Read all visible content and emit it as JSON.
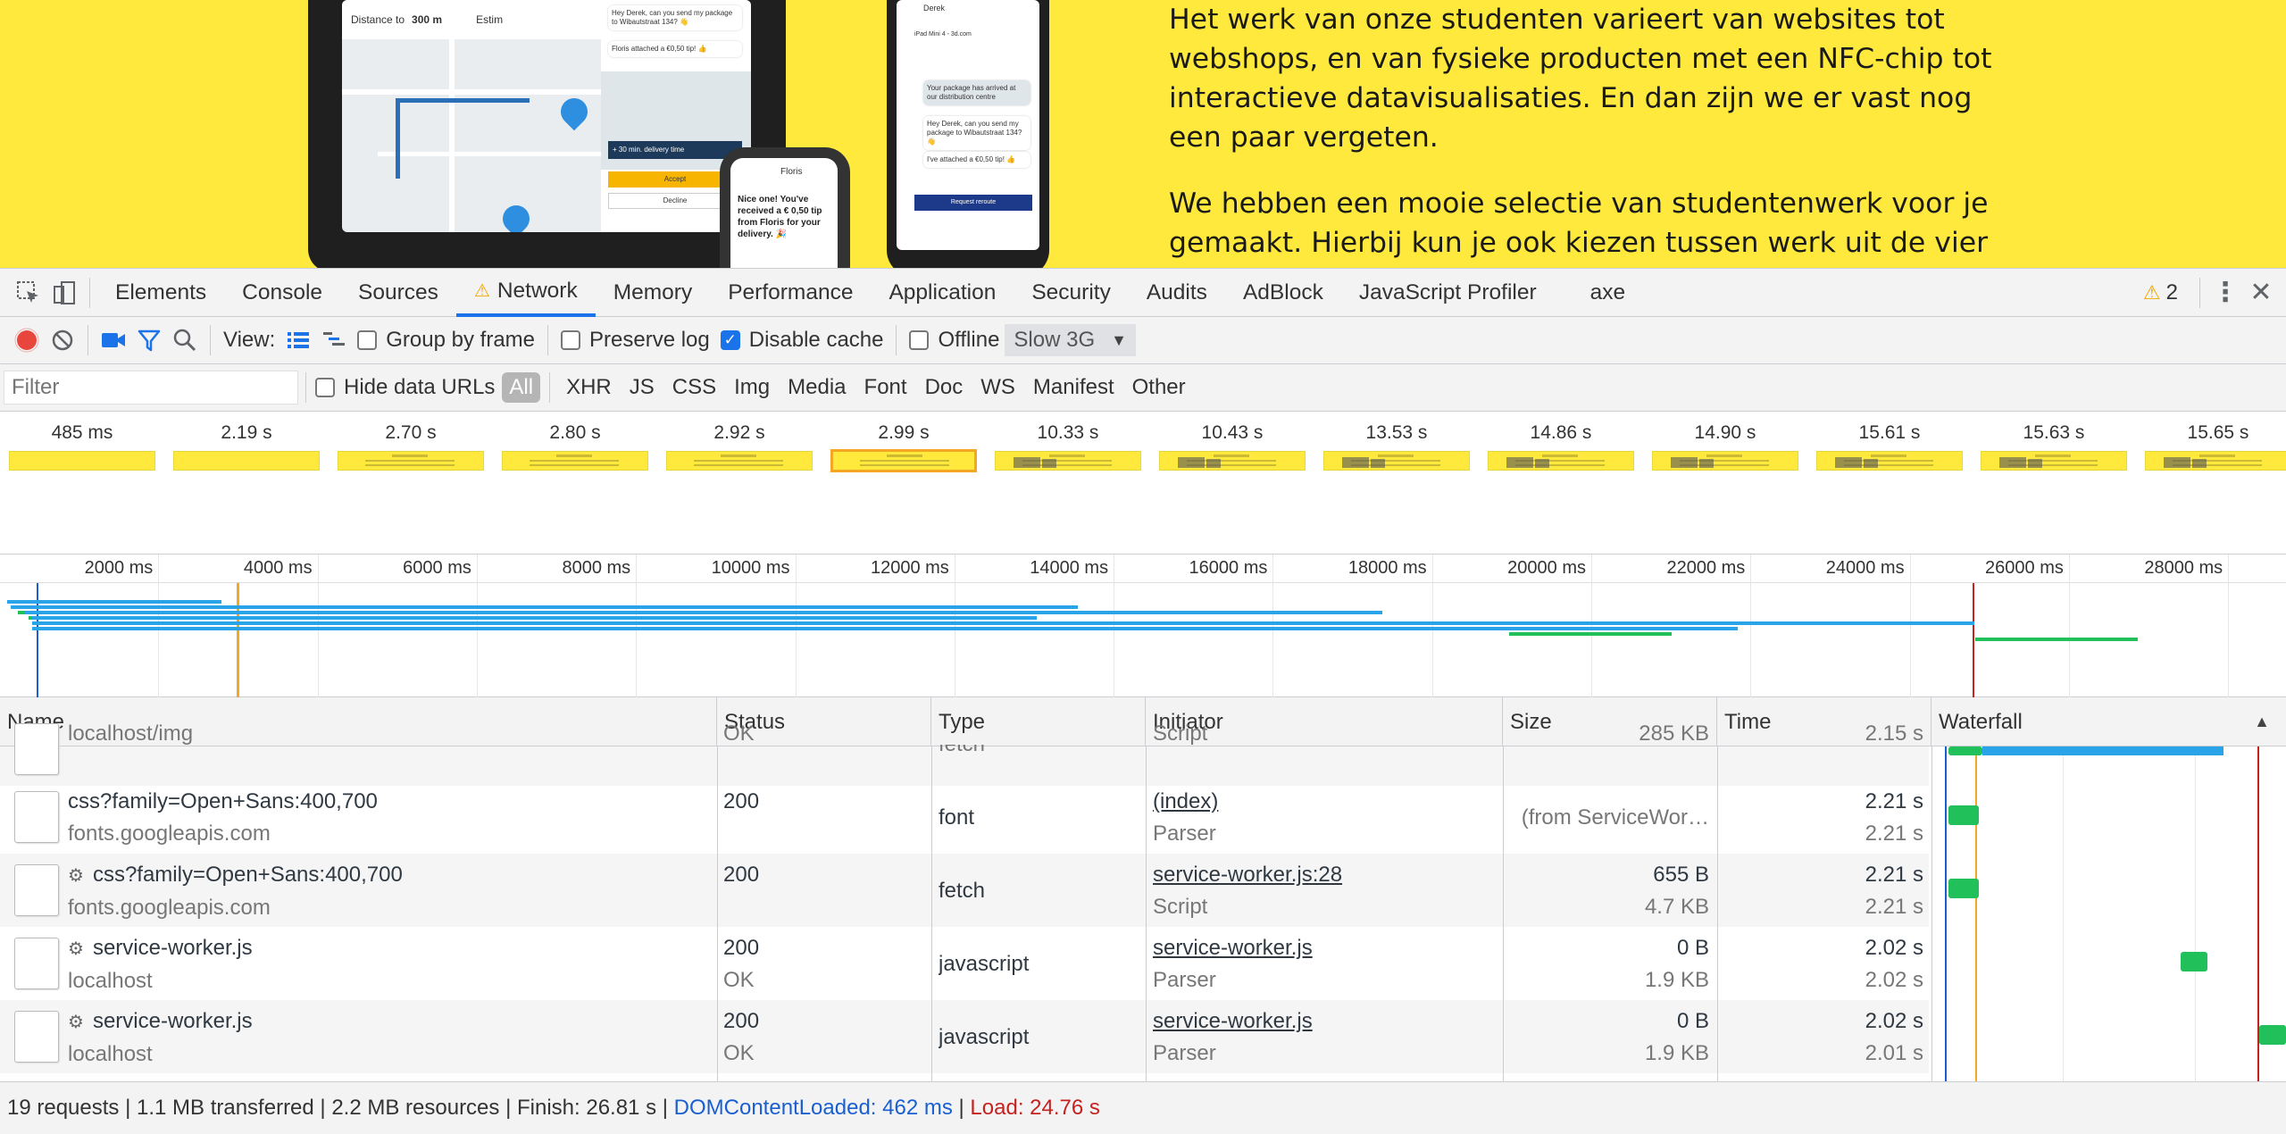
{
  "page": {
    "paragraph1": "Het werk van onze studenten varieert van websites tot webshops, en van fysieke producten met een NFC-chip tot interactieve datavisualisaties. En dan zijn we er vast nog een paar vergeten.",
    "paragraph2": "We hebben een mooie selectie van studentenwerk voor je gemaakt. Hierbij kun je ook kiezen tussen werk uit de vier",
    "tablet": {
      "distance_label": "Distance to",
      "distance_value": "300 m",
      "estimate_label": "Estim",
      "accept": "Accept",
      "decline": "Decline",
      "delivery": "+ 30 min. delivery time",
      "chat1": "Hey Derek, can you send my package to Wibautstraat 134? 👋",
      "chat2": "Floris attached a €0,50 tip! 👍"
    },
    "watch": {
      "name": "Floris",
      "message": "Nice one! You've received a € 0,50 tip from Floris for your delivery. 🎉"
    },
    "phone": {
      "contact": "Derek",
      "device": "iPad Mini 4 - 3d.com",
      "chat1": "Your package has arrived at our distribution centre",
      "chat2": "Hey Derek, can you send my package to Wibautstraat 134? 👋",
      "chat3": "I've attached a €0,50 tip! 👍",
      "button": "Request reroute"
    }
  },
  "devtools": {
    "tabs": [
      "Elements",
      "Console",
      "Sources",
      "Network",
      "Memory",
      "Performance",
      "Application",
      "Security",
      "Audits",
      "AdBlock",
      "JavaScript Profiler",
      "axe"
    ],
    "active_tab": "Network",
    "warnings_count": "2",
    "toolbar": {
      "view_label": "View:",
      "group_by_frame": "Group by frame",
      "preserve_log": "Preserve log",
      "disable_cache": "Disable cache",
      "offline": "Offline",
      "throttle": "Slow 3G"
    },
    "filter": {
      "placeholder": "Filter",
      "hide_data_urls": "Hide data URLs",
      "types": [
        "All",
        "XHR",
        "JS",
        "CSS",
        "Img",
        "Media",
        "Font",
        "Doc",
        "WS",
        "Manifest",
        "Other"
      ],
      "active_type": "All"
    },
    "filmstrip": [
      "485 ms",
      "2.19 s",
      "2.70 s",
      "2.80 s",
      "2.92 s",
      "2.99 s",
      "10.33 s",
      "10.43 s",
      "13.53 s",
      "14.86 s",
      "14.90 s",
      "15.61 s",
      "15.63 s",
      "15.65 s"
    ],
    "filmstrip_selected": 5,
    "overview_ticks": [
      "2000 ms",
      "4000 ms",
      "6000 ms",
      "8000 ms",
      "10000 ms",
      "12000 ms",
      "14000 ms",
      "16000 ms",
      "18000 ms",
      "20000 ms",
      "22000 ms",
      "24000 ms",
      "26000 ms",
      "28000 ms"
    ],
    "columns": [
      "Name",
      "Status",
      "Type",
      "Initiator",
      "Size",
      "Time",
      "Waterfall"
    ],
    "rows": [
      {
        "name": "",
        "domain": "localhost/img",
        "status": "",
        "status_text": "OK",
        "type": "fetch",
        "initiator": "",
        "initiator_type": "Script",
        "size": "",
        "size2": "285 KB",
        "time": "",
        "time2": "2.15 s",
        "gear": false
      },
      {
        "name": "css?family=Open+Sans:400,700",
        "domain": "fonts.googleapis.com",
        "status": "200",
        "status_text": "",
        "type": "font",
        "initiator": "(index)",
        "initiator_type": "Parser",
        "size": "(from ServiceWor…",
        "size2": "",
        "time": "2.21 s",
        "time2": "2.21 s",
        "gear": false
      },
      {
        "name": "css?family=Open+Sans:400,700",
        "domain": "fonts.googleapis.com",
        "status": "200",
        "status_text": "",
        "type": "fetch",
        "initiator": "service-worker.js:28",
        "initiator_type": "Script",
        "size": "655 B",
        "size2": "4.7 KB",
        "time": "2.21 s",
        "time2": "2.21 s",
        "gear": true
      },
      {
        "name": "service-worker.js",
        "domain": "localhost",
        "status": "200",
        "status_text": "OK",
        "type": "javascript",
        "initiator": "service-worker.js",
        "initiator_type": "Parser",
        "size": "0 B",
        "size2": "1.9 KB",
        "time": "2.02 s",
        "time2": "2.02 s",
        "gear": true
      },
      {
        "name": "service-worker.js",
        "domain": "localhost",
        "status": "200",
        "status_text": "OK",
        "type": "javascript",
        "initiator": "service-worker.js",
        "initiator_type": "Parser",
        "size": "0 B",
        "size2": "1.9 KB",
        "time": "2.02 s",
        "time2": "2.01 s",
        "gear": true
      }
    ],
    "summary": {
      "requests": "19 requests",
      "transferred": "1.1 MB transferred",
      "resources": "2.2 MB resources",
      "finish": "Finish: 26.81 s",
      "dcl": "DOMContentLoaded: 462 ms",
      "load": "Load: 24.76 s"
    }
  }
}
